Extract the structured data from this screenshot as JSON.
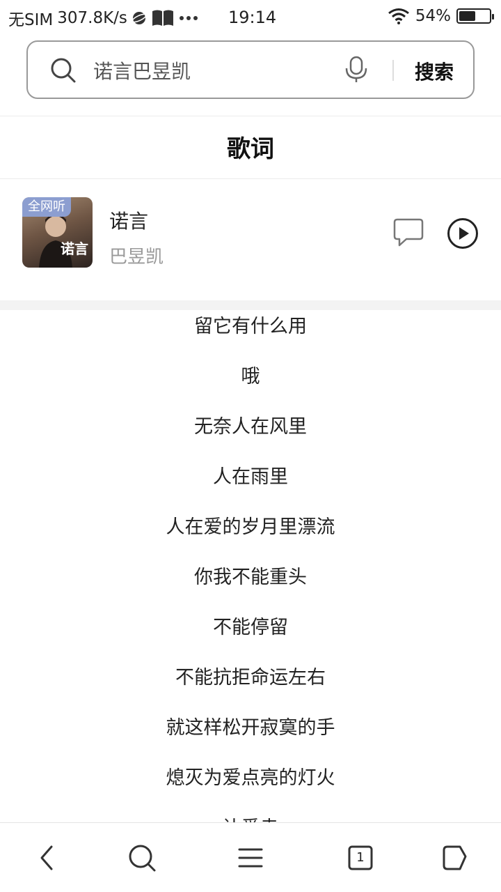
{
  "status_bar": {
    "carrier": "无SIM",
    "network_speed": "307.8K/s",
    "time": "19:14",
    "battery": "54%",
    "battery_level": 0.54,
    "icons": [
      "planet-icon",
      "book-icon",
      "more-dots-icon",
      "wifi-icon",
      "battery-icon"
    ]
  },
  "search": {
    "query": "诺言巴昱凯",
    "button_label": "搜索"
  },
  "section_title": "歌词",
  "song": {
    "badge": "全网听",
    "album_text": "诺言",
    "title": "诺言",
    "artist": "巴昱凯"
  },
  "lyrics": [
    "留它有什么用",
    "哦",
    "无奈人在风里",
    "人在雨里",
    "人在爱的岁月里漂流",
    "你我不能重头",
    "不能停留",
    "不能抗拒命运左右",
    "就这样松开寂寞的手",
    "熄灭为爱点亮的灯火",
    "让爱走"
  ],
  "bottom_nav": {
    "tab_count": "1",
    "items": [
      "back-icon",
      "search-icon",
      "menu-icon",
      "tabs-icon",
      "home-icon"
    ]
  },
  "colors": {
    "badge": "#8c9ed0",
    "muted_text": "#999999",
    "divider": "#ececec"
  }
}
